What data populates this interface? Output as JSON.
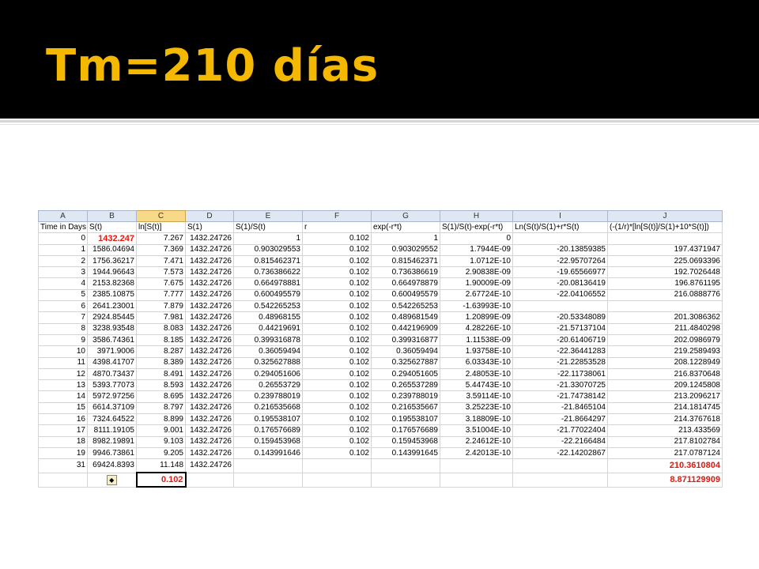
{
  "title": "Tm=210 días",
  "sheet": {
    "col_letters": [
      "A",
      "B",
      "C",
      "D",
      "E",
      "F",
      "G",
      "H",
      "I",
      "J"
    ],
    "headers": [
      "Time in Days",
      "S(t)",
      "ln[S(t)]",
      "S(1)",
      "S(1)/S(t)",
      "r",
      "exp(-r*t)",
      "S(1)/S(t)-exp(-r*t)",
      "Ln(S(t)/S(1)+r*S(t)",
      "(-(1/r)*[ln[S(t)]/S(1)+10*S(t)])"
    ],
    "rows": [
      [
        "0",
        "1432.247",
        "7.267",
        "1432.24726",
        "1",
        "0.102",
        "1",
        "0",
        "",
        ""
      ],
      [
        "1",
        "1586.04694",
        "7.369",
        "1432.24726",
        "0.903029553",
        "0.102",
        "0.903029552",
        "1.7944E-09",
        "-20.13859385",
        "197.4371947"
      ],
      [
        "2",
        "1756.36217",
        "7.471",
        "1432.24726",
        "0.815462371",
        "0.102",
        "0.815462371",
        "1.0712E-10",
        "-22.95707264",
        "225.0693396"
      ],
      [
        "3",
        "1944.96643",
        "7.573",
        "1432.24726",
        "0.736386622",
        "0.102",
        "0.736386619",
        "2.90838E-09",
        "-19.65566977",
        "192.7026448"
      ],
      [
        "4",
        "2153.82368",
        "7.675",
        "1432.24726",
        "0.664978881",
        "0.102",
        "0.664978879",
        "1.90009E-09",
        "-20.08136419",
        "196.8761195"
      ],
      [
        "5",
        "2385.10875",
        "7.777",
        "1432.24726",
        "0.600495579",
        "0.102",
        "0.600495579",
        "2.67724E-10",
        "-22.04106552",
        "216.0888776"
      ],
      [
        "6",
        "2641.23001",
        "7.879",
        "1432.24726",
        "0.542265253",
        "0.102",
        "0.542265253",
        "-1.63993E-10",
        "",
        ""
      ],
      [
        "7",
        "2924.85445",
        "7.981",
        "1432.24726",
        "0.48968155",
        "0.102",
        "0.489681549",
        "1.20899E-09",
        "-20.53348089",
        "201.3086362"
      ],
      [
        "8",
        "3238.93548",
        "8.083",
        "1432.24726",
        "0.44219691",
        "0.102",
        "0.442196909",
        "4.28226E-10",
        "-21.57137104",
        "211.4840298"
      ],
      [
        "9",
        "3586.74361",
        "8.185",
        "1432.24726",
        "0.399316878",
        "0.102",
        "0.399316877",
        "1.11538E-09",
        "-20.61406719",
        "202.0986979"
      ],
      [
        "10",
        "3971.9006",
        "8.287",
        "1432.24726",
        "0.36059494",
        "0.102",
        "0.36059494",
        "1.93758E-10",
        "-22.36441283",
        "219.2589493"
      ],
      [
        "11",
        "4398.41707",
        "8.389",
        "1432.24726",
        "0.325627888",
        "0.102",
        "0.325627887",
        "6.03343E-10",
        "-21.22853528",
        "208.1228949"
      ],
      [
        "12",
        "4870.73437",
        "8.491",
        "1432.24726",
        "0.294051606",
        "0.102",
        "0.294051605",
        "2.48053E-10",
        "-22.11738061",
        "216.8370648"
      ],
      [
        "13",
        "5393.77073",
        "8.593",
        "1432.24726",
        "0.26553729",
        "0.102",
        "0.265537289",
        "5.44743E-10",
        "-21.33070725",
        "209.1245808"
      ],
      [
        "14",
        "5972.97256",
        "8.695",
        "1432.24726",
        "0.239788019",
        "0.102",
        "0.239788019",
        "3.59114E-10",
        "-21.74738142",
        "213.2096217"
      ],
      [
        "15",
        "6614.37109",
        "8.797",
        "1432.24726",
        "0.216535668",
        "0.102",
        "0.216535667",
        "3.25223E-10",
        "-21.8465104",
        "214.1814745"
      ],
      [
        "16",
        "7324.64522",
        "8.899",
        "1432.24726",
        "0.195538107",
        "0.102",
        "0.195538107",
        "3.18809E-10",
        "-21.8664297",
        "214.3767618"
      ],
      [
        "17",
        "8111.19105",
        "9.001",
        "1432.24726",
        "0.176576689",
        "0.102",
        "0.176576689",
        "3.51004E-10",
        "-21.77022404",
        "213.433569"
      ],
      [
        "18",
        "8982.19891",
        "9.103",
        "1432.24726",
        "0.159453968",
        "0.102",
        "0.159453968",
        "2.24612E-10",
        "-22.2166484",
        "217.8102784"
      ],
      [
        "19",
        "9946.73861",
        "9.205",
        "1432.24726",
        "0.143991646",
        "0.102",
        "0.143991645",
        "2.42013E-10",
        "-22.14202867",
        "217.0787124"
      ],
      [
        "31",
        "69424.8393",
        "11.148",
        "1432.24726",
        "",
        "",
        "",
        "",
        "",
        "210.3610804"
      ],
      [
        "",
        "",
        "0.102",
        "",
        "",
        "",
        "",
        "",
        "",
        "8.871129909"
      ]
    ]
  }
}
